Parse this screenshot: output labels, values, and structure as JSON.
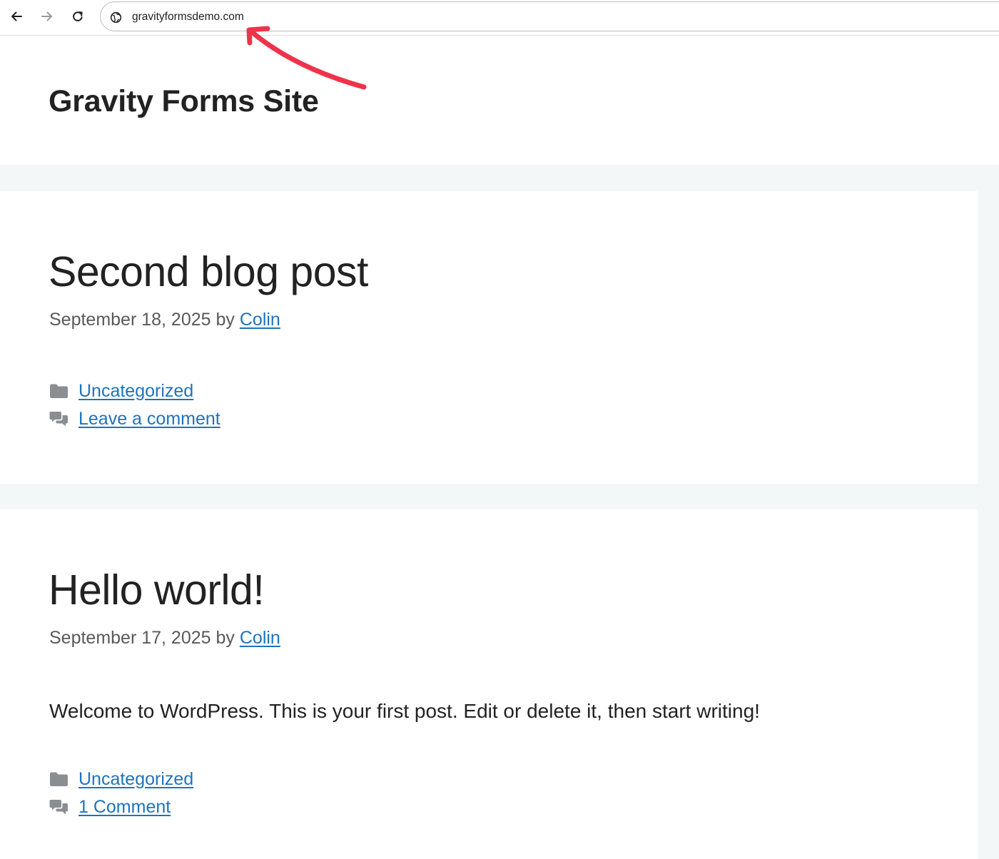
{
  "browser": {
    "url": "gravityformsdemo.com",
    "back_icon": "arrow-left-icon",
    "forward_icon": "arrow-right-icon",
    "reload_icon": "reload-icon",
    "site_info_icon": "globe-icon"
  },
  "annotation": {
    "arrow_color": "#f0324a",
    "arrow_icon": "curved-arrow-icon"
  },
  "site": {
    "title": "Gravity Forms Site"
  },
  "colors": {
    "link": "#1e73be",
    "content_background": "#f4f7f8",
    "meta_text": "#595959"
  },
  "posts": [
    {
      "title": "Second blog post",
      "date": "September 18, 2025",
      "by": " by ",
      "author": "Colin",
      "excerpt": "",
      "category_icon": "folder-icon",
      "category": "Uncategorized",
      "comments_icon": "comments-icon",
      "comments": "Leave a comment"
    },
    {
      "title": "Hello world!",
      "date": "September 17, 2025",
      "by": " by ",
      "author": "Colin",
      "excerpt": "Welcome to WordPress. This is your first post. Edit or delete it, then start writing!",
      "category_icon": "folder-icon",
      "category": "Uncategorized",
      "comments_icon": "comments-icon",
      "comments": "1 Comment"
    }
  ]
}
